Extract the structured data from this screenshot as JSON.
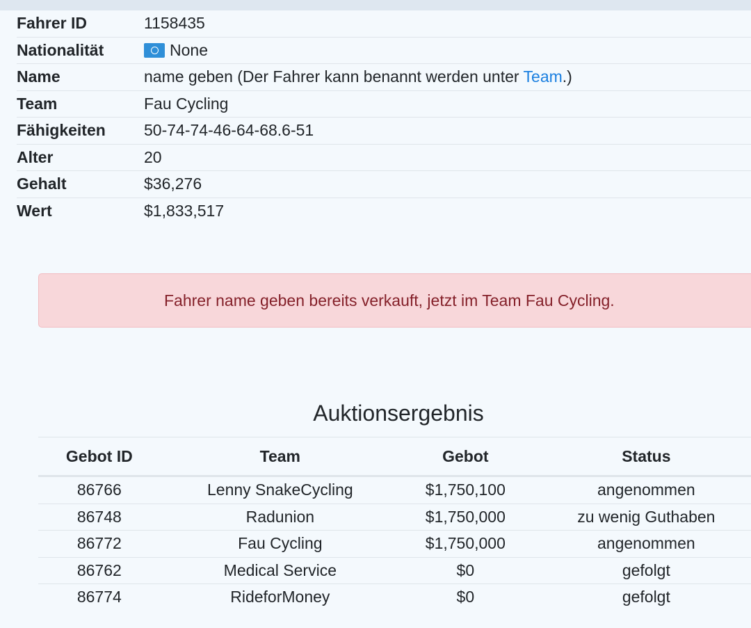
{
  "driver": {
    "rows": [
      {
        "label": "Fahrer ID",
        "value": "1158435"
      },
      {
        "label": "Nationalität",
        "value": "None",
        "flag_icon": "un-flag-icon"
      },
      {
        "label": "Name",
        "value_before": "name geben (Der Fahrer kann benannt werden unter ",
        "link": "Team",
        "value_after": ".)"
      },
      {
        "label": "Team",
        "value": "Fau Cycling"
      },
      {
        "label": "Fähigkeiten",
        "value": "50-74-74-46-64-68.6-51"
      },
      {
        "label": "Alter",
        "value": "20"
      },
      {
        "label": "Gehalt",
        "value": "$36,276"
      },
      {
        "label": "Wert",
        "value": "$1,833,517"
      }
    ]
  },
  "alert": {
    "message": "Fahrer name geben bereits verkauft, jetzt im Team Fau Cycling."
  },
  "auction": {
    "title": "Auktionsergebnis",
    "columns": [
      "Gebot ID",
      "Team",
      "Gebot",
      "Status"
    ],
    "rows": [
      [
        "86766",
        "Lenny SnakeCycling",
        "$1,750,100",
        "angenommen"
      ],
      [
        "86748",
        "Radunion",
        "$1,750,000",
        "zu wenig Guthaben"
      ],
      [
        "86772",
        "Fau Cycling",
        "$1,750,000",
        "angenommen"
      ],
      [
        "86762",
        "Medical Service",
        "$0",
        "gefolgt"
      ],
      [
        "86774",
        "RideforMoney",
        "$0",
        "gefolgt"
      ]
    ]
  },
  "colors": {
    "background": "#f4f9fd",
    "link": "#1a7fe0",
    "alert_bg": "#f8d7da",
    "alert_text": "#842029"
  }
}
